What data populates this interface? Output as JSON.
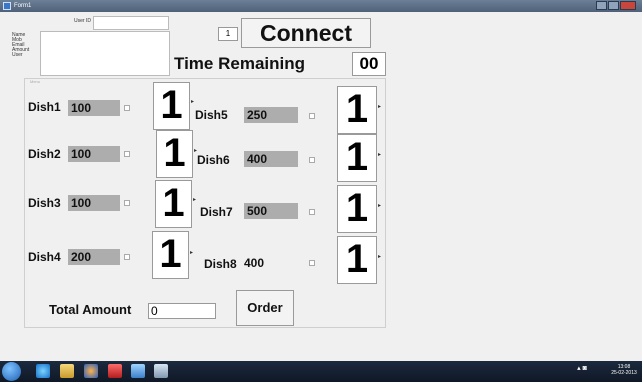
{
  "window": {
    "title": "Form1"
  },
  "header": {
    "user_id_label": "User ID",
    "info_labels": [
      "Name",
      "Mob",
      "Email",
      "Amount",
      "User"
    ],
    "small_spinner_value": "1",
    "connect_label": "Connect",
    "time_remaining_label": "Time Remaining",
    "time_remaining_value": "00"
  },
  "menu": {
    "group_caption": "Menu",
    "left_dishes": [
      {
        "name": "Dish1",
        "price": "100",
        "qty": "1"
      },
      {
        "name": "Dish2",
        "price": "100",
        "qty": "1"
      },
      {
        "name": "Dish3",
        "price": "100",
        "qty": "1"
      },
      {
        "name": "Dish4",
        "price": "200",
        "qty": "1"
      }
    ],
    "right_dishes": [
      {
        "name": "Dish5",
        "price": "250",
        "qty": "1"
      },
      {
        "name": "Dish6",
        "price": "400",
        "qty": "1"
      },
      {
        "name": "Dish7",
        "price": "500",
        "qty": "1"
      },
      {
        "name": "Dish8",
        "price": "400",
        "qty": "1"
      }
    ]
  },
  "footer": {
    "total_label": "Total Amount",
    "total_value": "0",
    "order_label": "Order"
  },
  "taskbar": {
    "time": "13:08",
    "date": "25-02-2013"
  }
}
